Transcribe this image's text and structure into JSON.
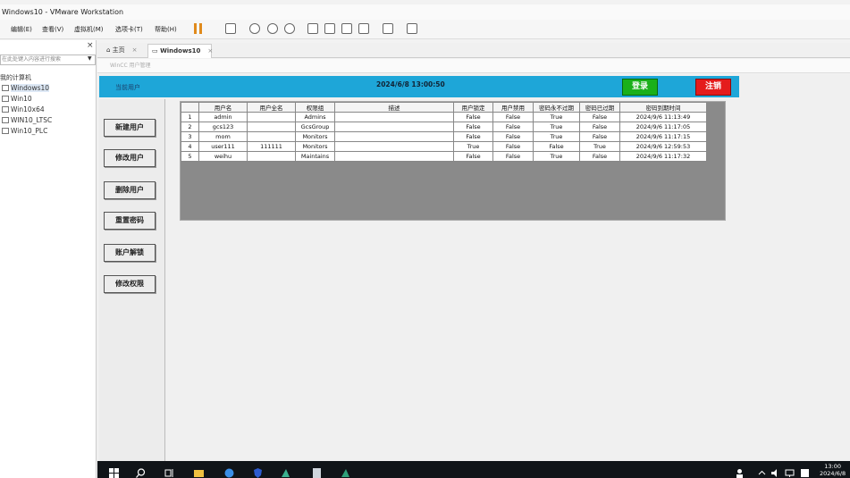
{
  "window": {
    "title": "Windows10 - VMware Workstation"
  },
  "menubar": {
    "items": [
      "编辑(E)",
      "查看(V)",
      "虚拟机(M)",
      "选项卡(T)",
      "帮助(H)"
    ]
  },
  "library": {
    "close_glyph": "×",
    "search_placeholder": "在此处键入内容进行搜索",
    "root_label": "我的计算机",
    "vms": [
      "Windows10",
      "Win10",
      "Win10x64",
      "WIN10_LTSC",
      "Win10_PLC"
    ],
    "selected_vm": "Windows10"
  },
  "tabs": [
    {
      "label": "主页",
      "active": false
    },
    {
      "label": "Windows10",
      "active": true
    }
  ],
  "address_hint": "WinCC 用户管理",
  "app": {
    "current_user_label": "当前用户",
    "datetime": "2024/6/8 13:00:50",
    "login_label": "登录",
    "logout_label": "注销",
    "side_buttons": [
      "新建用户",
      "修改用户",
      "删除用户",
      "重置密码",
      "账户解锁",
      "修改权限"
    ],
    "grid": {
      "columns": [
        "",
        "用户名",
        "用户全名",
        "权限组",
        "描述",
        "用户锁定",
        "用户禁用",
        "密码永不过期",
        "密码已过期",
        "密码到期时间"
      ],
      "rows": [
        [
          "1",
          "admin",
          "",
          "Admins",
          "",
          "False",
          "False",
          "True",
          "False",
          "2024/9/6 11:13:49"
        ],
        [
          "2",
          "gcs123",
          "",
          "GcsGroup",
          "",
          "False",
          "False",
          "True",
          "False",
          "2024/9/6 11:17:05"
        ],
        [
          "3",
          "mom",
          "",
          "Monitors",
          "",
          "False",
          "False",
          "True",
          "False",
          "2024/9/6 11:17:15"
        ],
        [
          "4",
          "user111",
          "111111",
          "Monitors",
          "",
          "True",
          "False",
          "False",
          "True",
          "2024/9/6 12:59:53"
        ],
        [
          "5",
          "weihu",
          "",
          "Maintains",
          "",
          "False",
          "False",
          "True",
          "False",
          "2024/9/6 11:17:32"
        ]
      ]
    }
  },
  "taskbar": {
    "time": "13:00",
    "date": "2024/6/8"
  },
  "colors": {
    "header": "#1ea6d8",
    "login": "#1ab01a",
    "logout": "#e41c1c"
  }
}
